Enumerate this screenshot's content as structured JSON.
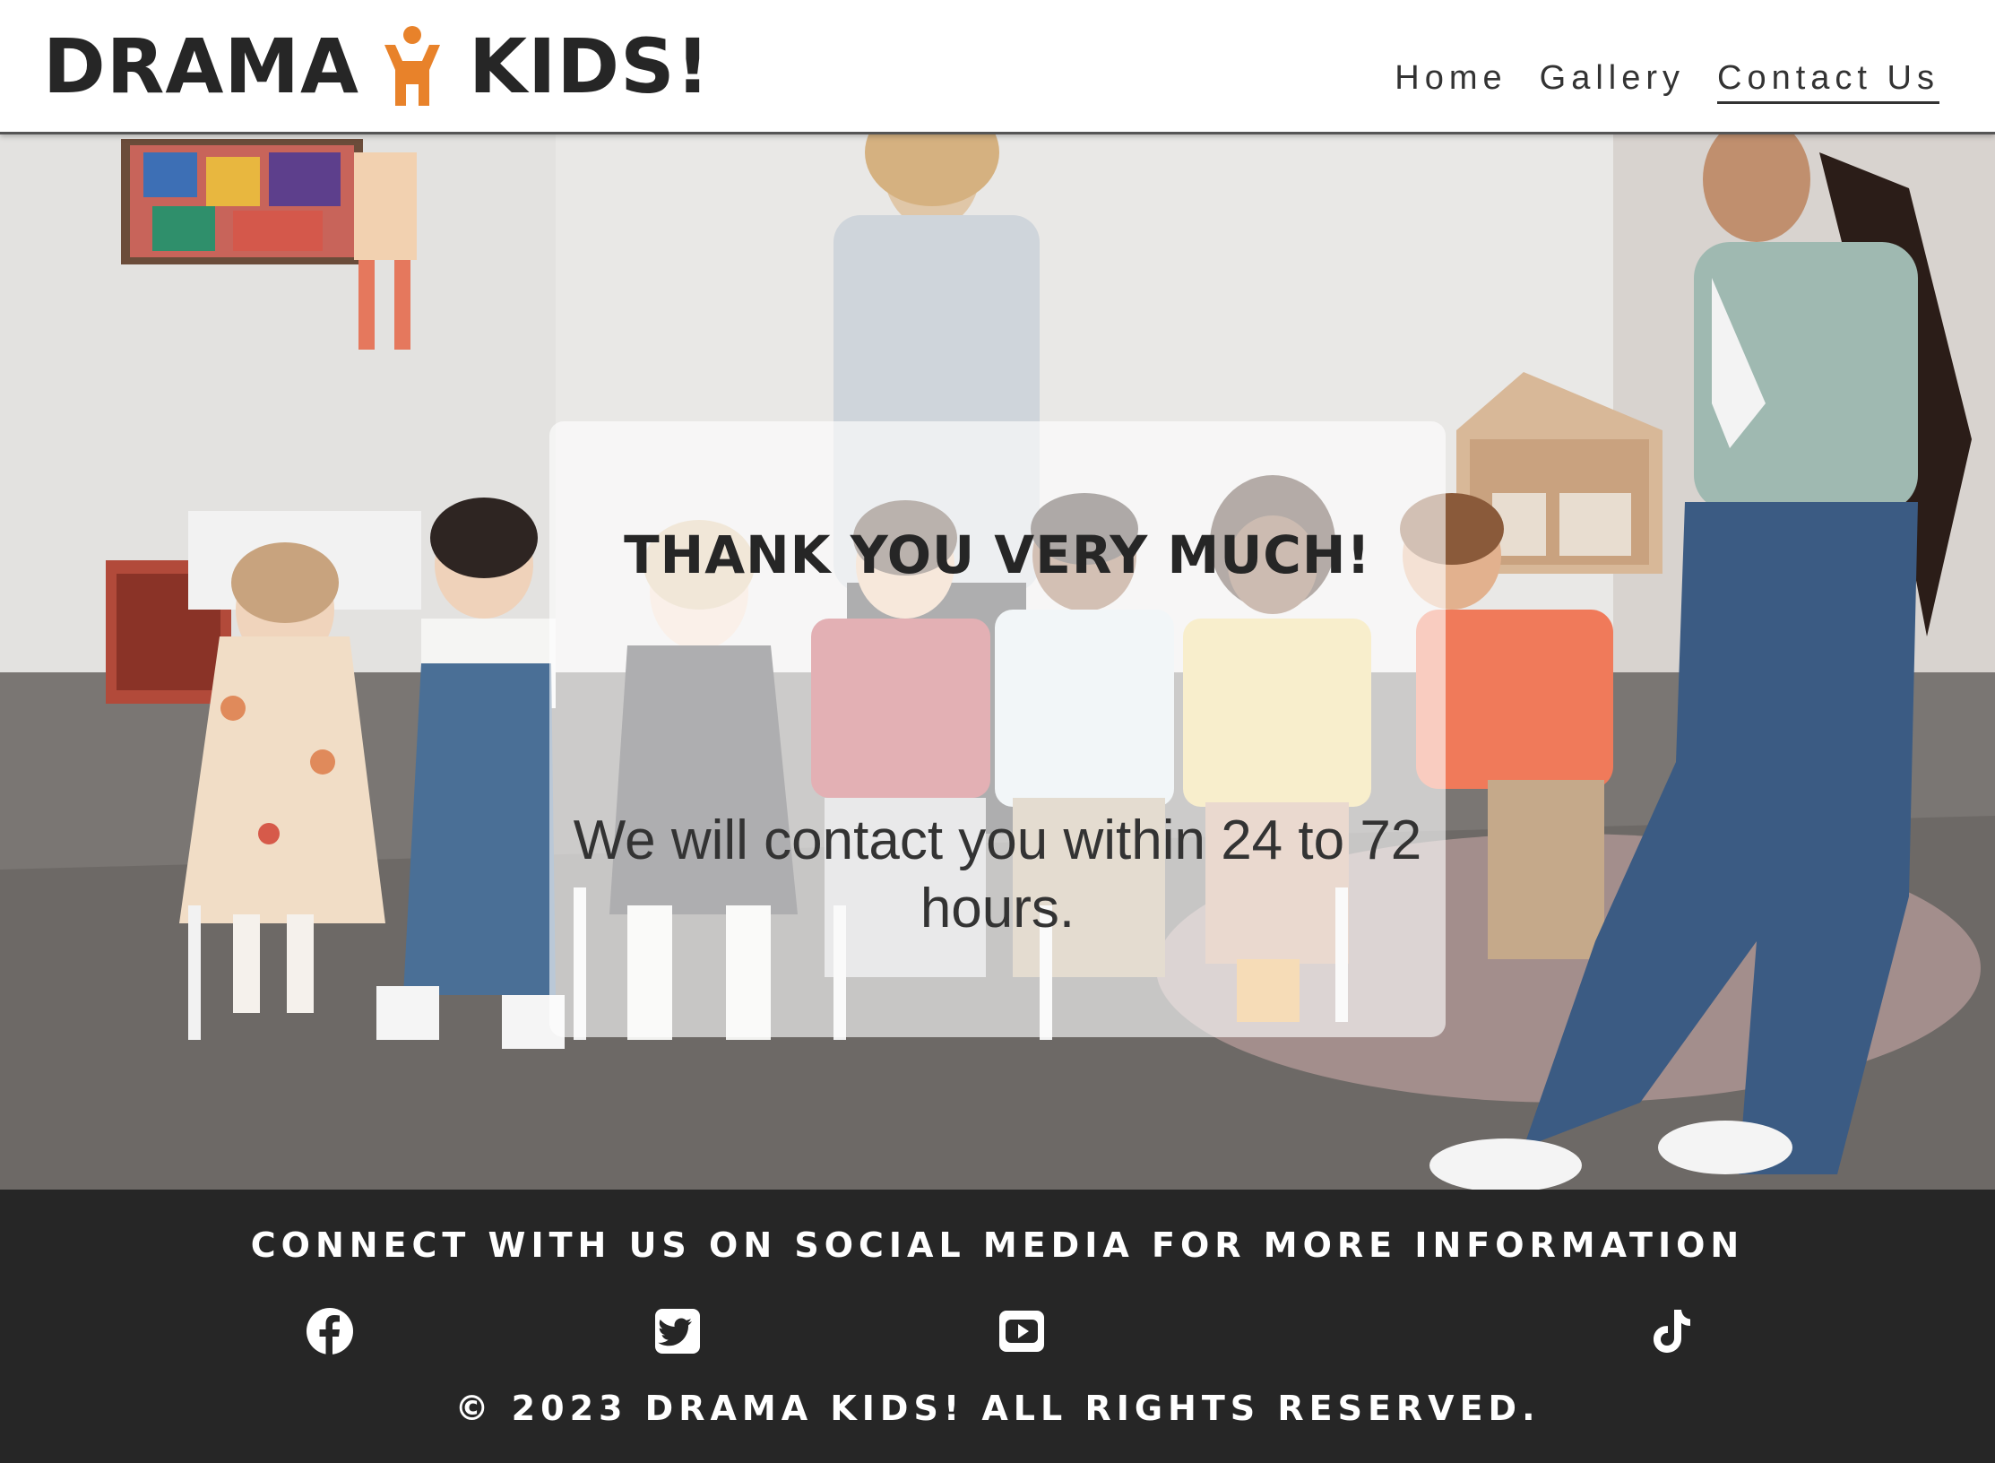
{
  "header": {
    "logo_word_1": "DRAMA",
    "logo_word_2": "KIDS!",
    "logo_icon": "person-icon",
    "logo_icon_color": "#e8822a",
    "nav": [
      {
        "label": "Home",
        "active": false
      },
      {
        "label": "Gallery",
        "active": false
      },
      {
        "label": "Contact Us",
        "active": true
      }
    ]
  },
  "hero": {
    "image": "classroom-photo-teacher-and-children",
    "card": {
      "title": "THANK YOU VERY MUCH!",
      "message": "We will contact you within 24 to 72 hours."
    }
  },
  "footer": {
    "heading": "CONNECT WITH US ON SOCIAL MEDIA FOR MORE INFORMATION",
    "social": [
      {
        "name": "facebook-icon"
      },
      {
        "name": "twitter-icon"
      },
      {
        "name": "youtube-icon"
      },
      {
        "name": "tiktok-icon"
      }
    ],
    "copyright": "© 2023 DRAMA KIDS! ALL RIGHTS RESERVED."
  },
  "colors": {
    "text_dark": "#262626",
    "footer_bg": "#262626",
    "accent_orange": "#e8822a"
  }
}
